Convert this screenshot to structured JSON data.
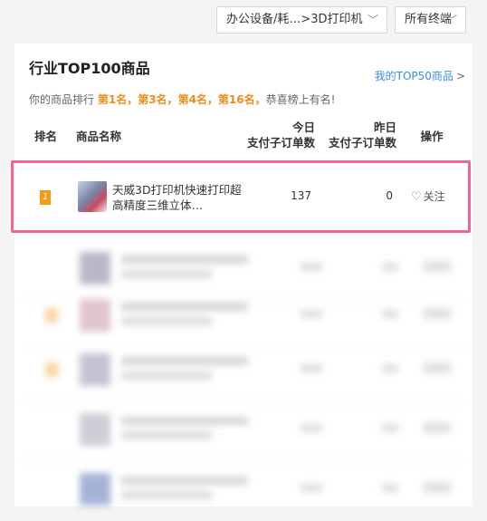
{
  "filters": {
    "category": "办公设备/耗…>3D打印机",
    "terminal": "所有终端",
    "chevron_icon": "chevron-down-icon"
  },
  "panel": {
    "title": "行业TOP100商品",
    "top50_link": "我的TOP50商品",
    "top50_arrow": ">",
    "rank_prefix": "你的商品排行",
    "ranks": [
      "第1名，",
      "第3名，",
      "第4名，",
      "第16名，"
    ],
    "rank_suffix": "恭喜榜上有名!"
  },
  "table": {
    "headers": {
      "rank": "排名",
      "name": "商品名称",
      "today_l1": "今日",
      "today_l2": "支付子订单数",
      "yesterday_l1": "昨日",
      "yesterday_l2": "支付子订单数",
      "action": "操作"
    },
    "rows": [
      {
        "rank": "1",
        "name": "天威3D打印机快速打印超高精度三维立体…",
        "today": "137",
        "yesterday": "0",
        "action": "关注",
        "action_icon": "heart-icon"
      }
    ]
  },
  "colors": {
    "highlight": "#f06496",
    "rank_orange": "#f08c1e",
    "link_blue": "#3a8ee6"
  }
}
